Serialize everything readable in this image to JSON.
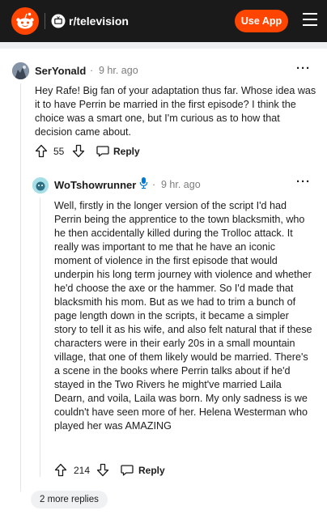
{
  "header": {
    "subreddit": "r/television",
    "use_app_label": "Use App"
  },
  "comments": [
    {
      "author": "SerYonald",
      "time": "9 hr. ago",
      "text": "Hey Rafe! Big fan of your adaptation thus far. Whose idea was it to have Perrin be married in the first episode? I think the choice was a smart one, but I'm curious as to how that decision came about.",
      "score": "55",
      "reply_label": "Reply",
      "more_glyph": "···"
    },
    {
      "author": "WoTshowrunner",
      "time": "9 hr. ago",
      "text": "Well, firstly in the longer version of the script I'd had Perrin being the apprentice to the town blacksmith, who he then accidentally killed during the Trolloc attack. It really was important to me that he have an iconic moment of violence in the first episode that would underpin his long term journey with violence and whether he'd choose the axe or the hammer. So I'd made that blacksmith his mom. But as we had to trim a bunch of page length down in the scripts, it became a simpler story to tell it as his wife, and also felt natural that if these characters were in their early 20s in a small mountain village, that one of them likely would be married. There's a scene in the books where Perrin talks about if he'd stayed in the Two Rivers he might've married Laila Dearn, and voila, Laila was born. My only sadness is we couldn't have seen more of her. Helena Westerman who played her was AMAZING",
      "score": "214",
      "reply_label": "Reply",
      "more_glyph": "···"
    }
  ],
  "separator": "·",
  "more_replies_label": "2 more replies",
  "icons": [
    "reddit-logo-icon",
    "tv-icon",
    "menu-icon",
    "upvote-icon",
    "downvote-icon",
    "reply-icon",
    "microphone-icon",
    "more-options-icon"
  ],
  "colors": {
    "header_bg": "#1a1a1b",
    "accent": "#ff4500",
    "mic_blue": "#0079d3",
    "muted_text": "#7c7c7c"
  }
}
